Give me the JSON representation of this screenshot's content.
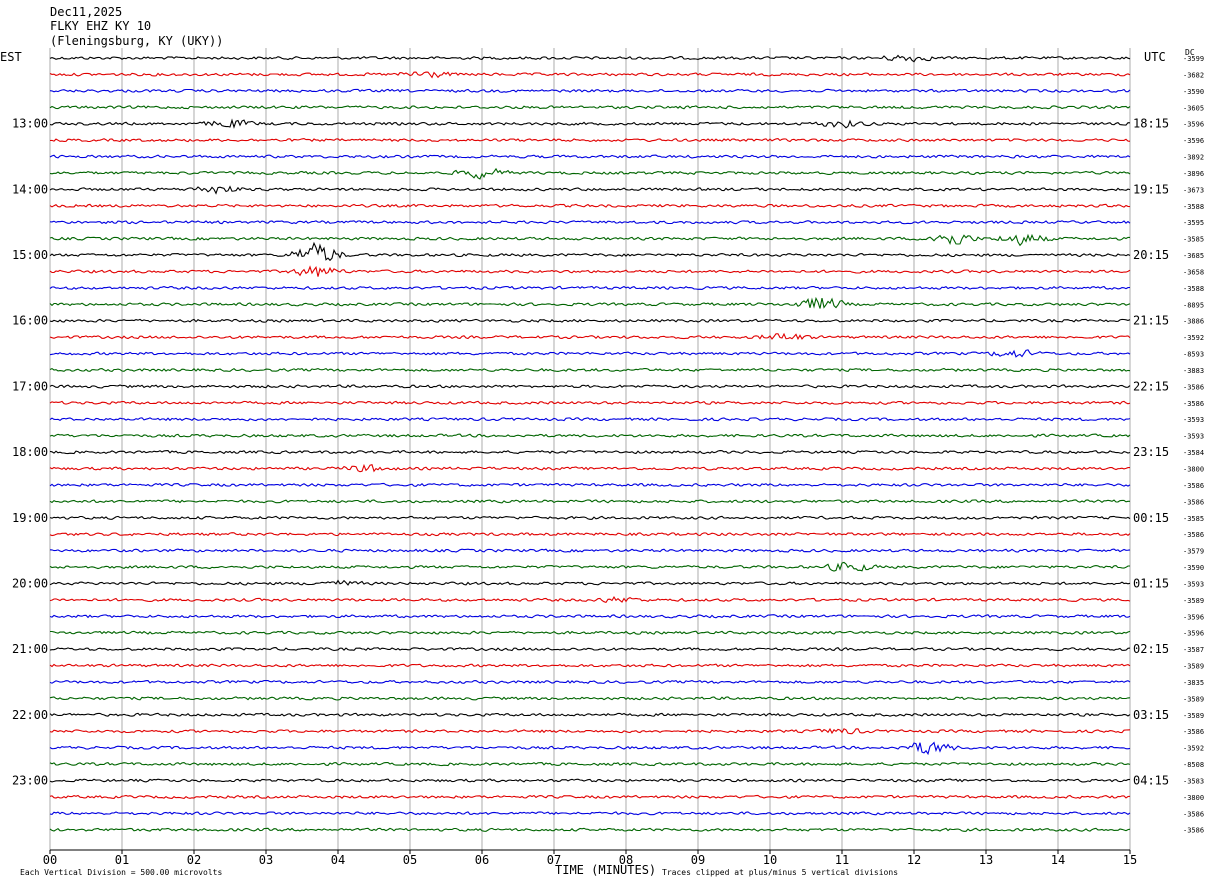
{
  "header": {
    "date": "Dec11,2025",
    "station": "FLKY EHZ KY 10",
    "location": "(Fleningsburg, KY (UKY))"
  },
  "left_tz": "EST",
  "right_tz": "UTC",
  "dc_header": "DC",
  "footer": {
    "scale": "Each Vertical Division =  500.00 microvolts",
    "xlabel": "TIME (MINUTES)",
    "clip": "Traces clipped at plus/minus 5 vertical divisions"
  },
  "colors": {
    "trace": [
      "#000000",
      "#e00000",
      "#0000e0",
      "#006400"
    ],
    "grid": "#888888"
  },
  "chart_data": {
    "type": "line",
    "title": "",
    "xlabel": "TIME (MINUTES)",
    "ylabel": "",
    "xlim": [
      0,
      15
    ],
    "x_ticks": [
      "00",
      "01",
      "02",
      "03",
      "04",
      "05",
      "06",
      "07",
      "08",
      "09",
      "10",
      "11",
      "12",
      "13",
      "14",
      "15"
    ],
    "trace_count": 48,
    "trace_minutes": 15,
    "left_hour_labels": [
      "13:00",
      "14:00",
      "15:00",
      "16:00",
      "17:00",
      "18:00",
      "19:00",
      "20:00",
      "21:00",
      "22:00",
      "23:00"
    ],
    "right_hour_labels": [
      "18:15",
      "19:15",
      "20:15",
      "21:15",
      "22:15",
      "23:15",
      "00:15",
      "01:15",
      "02:15",
      "03:15",
      "04:15"
    ],
    "dc_offsets": [
      "-3599",
      "-3682",
      "-3590",
      "-3605",
      "-3596",
      "-3596",
      "-3892",
      "-3896",
      "-3673",
      "-3588",
      "-3595",
      "-3585",
      "-3685",
      "-3658",
      "-3588",
      "-8895",
      "-3886",
      "-3592",
      "-8593",
      "-3883",
      "-3586",
      "-3586",
      "-3593",
      "-3593",
      "-3584",
      "-3800",
      "-3586",
      "-3586",
      "-3585",
      "-3586",
      "-3579",
      "-3590",
      "-3593",
      "-3589",
      "-3596",
      "-3596",
      "-3587",
      "-3589",
      "-3835",
      "-3589",
      "-3589",
      "-3586",
      "-3592",
      "-8508",
      "-3583",
      "-3800",
      "-3586",
      "-3586"
    ],
    "events": [
      {
        "trace": 0,
        "minute": 11.9,
        "amp": 1.4
      },
      {
        "trace": 1,
        "minute": 5.2,
        "amp": 1.6
      },
      {
        "trace": 4,
        "minute": 2.5,
        "amp": 1.6
      },
      {
        "trace": 4,
        "minute": 11.0,
        "amp": 1.4
      },
      {
        "trace": 7,
        "minute": 6.0,
        "amp": 2.2
      },
      {
        "trace": 8,
        "minute": 2.3,
        "amp": 1.6
      },
      {
        "trace": 11,
        "minute": 12.5,
        "amp": 3.0
      },
      {
        "trace": 11,
        "minute": 13.5,
        "amp": 2.5
      },
      {
        "trace": 12,
        "minute": 3.7,
        "amp": 5.0
      },
      {
        "trace": 13,
        "minute": 3.7,
        "amp": 2.5
      },
      {
        "trace": 15,
        "minute": 10.7,
        "amp": 3.0
      },
      {
        "trace": 17,
        "minute": 10.2,
        "amp": 1.5
      },
      {
        "trace": 18,
        "minute": 13.4,
        "amp": 1.6
      },
      {
        "trace": 25,
        "minute": 4.4,
        "amp": 1.4
      },
      {
        "trace": 31,
        "minute": 11.1,
        "amp": 2.0
      },
      {
        "trace": 32,
        "minute": 4.0,
        "amp": 1.0
      },
      {
        "trace": 33,
        "minute": 7.9,
        "amp": 1.0
      },
      {
        "trace": 41,
        "minute": 11.0,
        "amp": 1.0
      },
      {
        "trace": 42,
        "minute": 12.2,
        "amp": 3.0
      }
    ]
  }
}
